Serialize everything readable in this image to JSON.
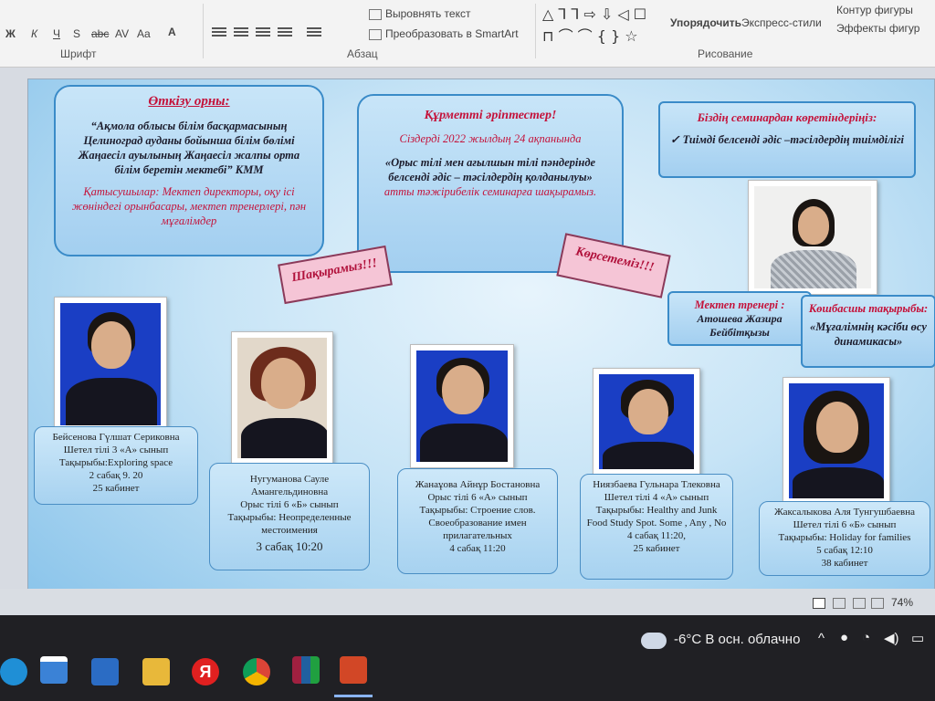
{
  "ribbon": {
    "group_font": "Шрифт",
    "group_paragraph": "Абзац",
    "group_drawing": "Рисование",
    "align_text": "Выровнять текст",
    "convert_smartart": "Преобразовать в SmartArt",
    "arrange": "Упорядочить",
    "quick_styles": "Экспресс-стили",
    "shape_outline": "Контур фигуры",
    "shape_effects": "Эффекты фигур",
    "font_letters": [
      "Ж",
      "К",
      "Ч",
      "S",
      "abc",
      "AV",
      "Aa",
      "A"
    ]
  },
  "slide": {
    "venue": {
      "title": "Өткізу орны:",
      "text": "“Ақмола облысы білім басқармасының Целиноград ауданы бойынша білім бөлімі Жаңаесіл ауылының Жаңаесіл жалпы орта білім беретін мектебі” КММ",
      "participants": "Қатысушылар: Мектеп директоры, оқу ісі жөніндегі орынбасары, мектеп тренерлері, пән мұғалімдер"
    },
    "invite": {
      "title": "Құрметті әріптестер!",
      "date_line": "Сіздерді 2022 жылдың 24 ақпанында",
      "topic": "«Орыс тілі мен ағылшын тілі пәндерінде белсенді әдіс – тәсілдердің қолданылуы»",
      "suffix": "атты тәжірибелік семинарға шақырамыз."
    },
    "aim": {
      "title": "Біздің семинардан көретіндеріңіз:",
      "item": "Тиімді белсенді әдіс –тәсілдердің тиімділігі"
    },
    "pink_invite": "Шақырамыз!!!",
    "pink_show": "Көрсетеміз!!!",
    "trainer": {
      "title": "Мектеп тренері :",
      "name": "Атошева Жазира Бейбітқызы"
    },
    "leader_topic": {
      "title": "Көшбасшы тақырыбы:",
      "text": "«Мұғалімнің кәсіби өсу динамикасы»"
    },
    "teachers": [
      {
        "name": "Бейсенова Гүлшат Сериковна",
        "lines": [
          "Шетел тілі 3 «А» сынып",
          "Тақырыбы:Exploring space",
          "2 сабақ 9. 20",
          "25 кабинет"
        ]
      },
      {
        "name": "Нугуманова Сауле Амангельдиновна",
        "lines": [
          "Орыс тілі 6 «Б» сынып",
          "Тақырыбы: Неопределенные местоимения",
          "3 сабақ 10:20"
        ]
      },
      {
        "name": "Жанаұова Айнұр Бостановна",
        "lines": [
          "Орыс тілі 6 «А» сынып",
          "Тақырыбы: Строение слов. Своеобразование имен прилагательных",
          "4 сабақ 11:20"
        ]
      },
      {
        "name": "Ниязбаева Гульнара Тлековна",
        "lines": [
          "Шетел тілі 4 «А» сынып",
          "Тақырыбы: Healthy and Junk Food Study Spot. Some , Any , No",
          "4 сабақ 11:20,",
          "25 кабинет"
        ]
      },
      {
        "name": "Жаксалыкова Аля Тунгушбаевна",
        "lines": [
          "Шетел тілі 6 «Б» сынып",
          "Тақырыбы: Holiday for families",
          "5 сабақ 12:10",
          "38 кабинет"
        ]
      }
    ]
  },
  "statusbar": {
    "zoom": "74%"
  },
  "taskbar": {
    "weather": "-6°C В осн. облачно",
    "yandex_glyph": "Я"
  },
  "colors": {
    "accent_red": "#c4123a",
    "box_border": "#3a8bc8",
    "pink": "#f5c5d6"
  }
}
